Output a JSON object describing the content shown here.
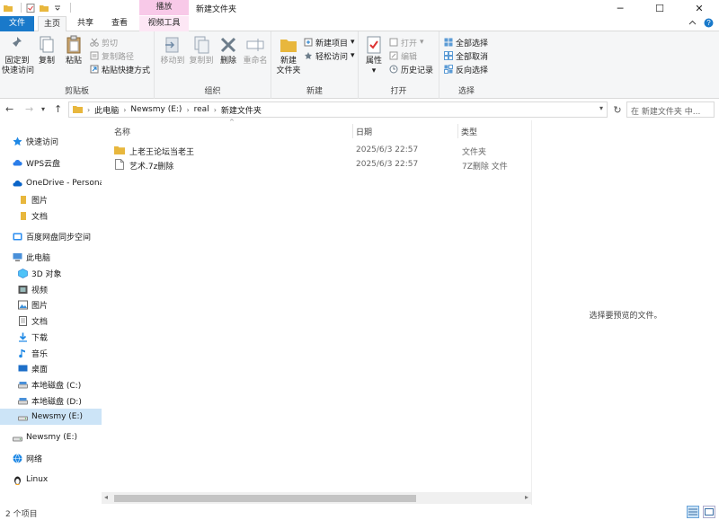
{
  "titlebar": {
    "context_tab": "播放",
    "title": "新建文件夹",
    "minimize": "─",
    "maximize": "☐",
    "close": "✕"
  },
  "ribbon_tabs": {
    "file": "文件",
    "home": "主页",
    "share": "共享",
    "view": "查看",
    "video_tools": "视频工具"
  },
  "ribbon": {
    "clipboard": {
      "label": "剪贴板",
      "pin": "固定到\n快速访问",
      "copy": "复制",
      "paste": "粘贴",
      "cut": "剪切",
      "copy_path": "复制路径",
      "paste_shortcut": "粘贴快捷方式"
    },
    "organize": {
      "label": "组织",
      "move_to": "移动到",
      "copy_to": "复制到",
      "delete": "删除",
      "rename": "重命名"
    },
    "new": {
      "label": "新建",
      "new_folder": "新建\n文件夹",
      "new_item": "新建项目",
      "easy_access": "轻松访问"
    },
    "open": {
      "label": "打开",
      "properties": "属性",
      "open": "打开",
      "edit": "编辑",
      "history": "历史记录"
    },
    "select": {
      "label": "选择",
      "select_all": "全部选择",
      "select_none": "全部取消",
      "invert": "反向选择"
    }
  },
  "address": {
    "crumbs": [
      "此电脑",
      "Newsmy (E:)",
      "real",
      "新建文件夹"
    ],
    "search_placeholder": "在 新建文件夹 中..."
  },
  "nav": {
    "items": [
      {
        "label": "快速访问",
        "icon": "star-icon"
      },
      {
        "label": "WPS云盘",
        "icon": "cloud-icon"
      },
      {
        "label": "OneDrive - Persona",
        "icon": "onedrive-icon"
      },
      {
        "label": "图片",
        "icon": "folder-icon"
      },
      {
        "label": "文档",
        "icon": "folder-icon"
      },
      {
        "label": "百度网盘同步空间",
        "icon": "baidu-icon"
      },
      {
        "label": "此电脑",
        "icon": "pc-icon"
      },
      {
        "label": "3D 对象",
        "icon": "cube-icon"
      },
      {
        "label": "视频",
        "icon": "video-icon"
      },
      {
        "label": "图片",
        "icon": "pictures-icon"
      },
      {
        "label": "文档",
        "icon": "documents-icon"
      },
      {
        "label": "下载",
        "icon": "download-icon"
      },
      {
        "label": "音乐",
        "icon": "music-icon"
      },
      {
        "label": "桌面",
        "icon": "desktop-icon"
      },
      {
        "label": "本地磁盘 (C:)",
        "icon": "drive-icon"
      },
      {
        "label": "本地磁盘 (D:)",
        "icon": "drive-icon"
      },
      {
        "label": "Newsmy (E:)",
        "icon": "usb-drive-icon"
      },
      {
        "label": "Newsmy (E:)",
        "icon": "usb-drive-icon"
      },
      {
        "label": "网络",
        "icon": "network-icon"
      },
      {
        "label": "Linux",
        "icon": "linux-icon"
      }
    ]
  },
  "files": {
    "columns": {
      "name": "名称",
      "date": "日期",
      "type": "类型"
    },
    "rows": [
      {
        "name": "上老王论坛当老王",
        "date": "2025/6/3 22:57",
        "type": "文件夹",
        "icon": "folder-icon"
      },
      {
        "name": "艺术.7z删除",
        "date": "2025/6/3 22:57",
        "type": "7Z删除 文件",
        "icon": "file-icon"
      }
    ]
  },
  "preview": {
    "message": "选择要预览的文件。"
  },
  "status": {
    "count": "2 个项目"
  }
}
